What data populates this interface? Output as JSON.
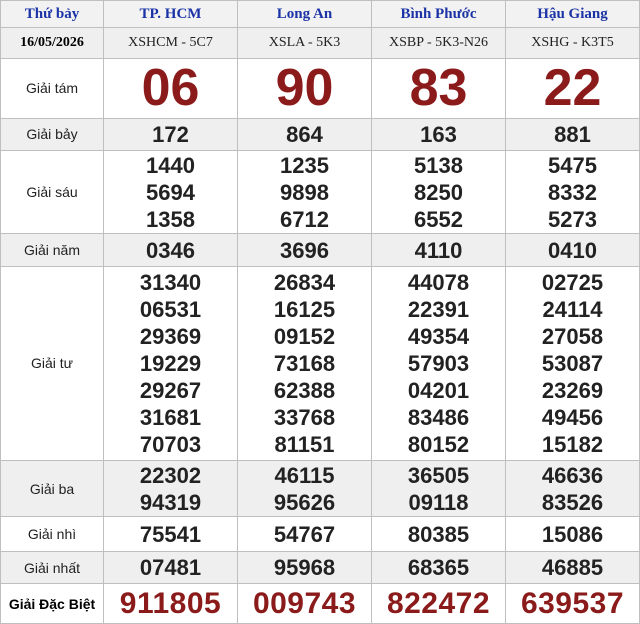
{
  "header": {
    "day": "Thứ bảy",
    "provinces": [
      "TP. HCM",
      "Long An",
      "Bình Phước",
      "Hậu Giang"
    ]
  },
  "codes": {
    "date": "16/05/2026",
    "values": [
      "XSHCM - 5C7",
      "XSLA - 5K3",
      "XSBP - 5K3-N26",
      "XSHG - K3T5"
    ]
  },
  "prizes": {
    "g8": {
      "label": "Giải tám",
      "values": [
        "06",
        "90",
        "83",
        "22"
      ]
    },
    "g7": {
      "label": "Giải bảy",
      "values": [
        "172",
        "864",
        "163",
        "881"
      ]
    },
    "g6": {
      "label": "Giải sáu",
      "values": [
        [
          "1440",
          "5694",
          "1358"
        ],
        [
          "1235",
          "9898",
          "6712"
        ],
        [
          "5138",
          "8250",
          "6552"
        ],
        [
          "5475",
          "8332",
          "5273"
        ]
      ]
    },
    "g5": {
      "label": "Giải năm",
      "values": [
        "0346",
        "3696",
        "4110",
        "0410"
      ]
    },
    "g4": {
      "label": "Giải tư",
      "values": [
        [
          "31340",
          "06531",
          "29369",
          "19229",
          "29267",
          "31681",
          "70703"
        ],
        [
          "26834",
          "16125",
          "09152",
          "73168",
          "62388",
          "33768",
          "81151"
        ],
        [
          "44078",
          "22391",
          "49354",
          "57903",
          "04201",
          "83486",
          "80152"
        ],
        [
          "02725",
          "24114",
          "27058",
          "53087",
          "23269",
          "49456",
          "15182"
        ]
      ]
    },
    "g3": {
      "label": "Giải ba",
      "values": [
        [
          "22302",
          "94319"
        ],
        [
          "46115",
          "95626"
        ],
        [
          "36505",
          "09118"
        ],
        [
          "46636",
          "83526"
        ]
      ]
    },
    "g2": {
      "label": "Giải nhì",
      "values": [
        "75541",
        "54767",
        "80385",
        "15086"
      ]
    },
    "g1": {
      "label": "Giải nhất",
      "values": [
        "07481",
        "95968",
        "68365",
        "46885"
      ]
    },
    "db": {
      "label": "Giải Đặc Biệt",
      "values": [
        "911805",
        "009743",
        "822472",
        "639537"
      ]
    }
  },
  "colors": {
    "header_text": "#1b33a6",
    "special_numbers": "#8b1a1a",
    "shaded_row": "#efefef"
  }
}
